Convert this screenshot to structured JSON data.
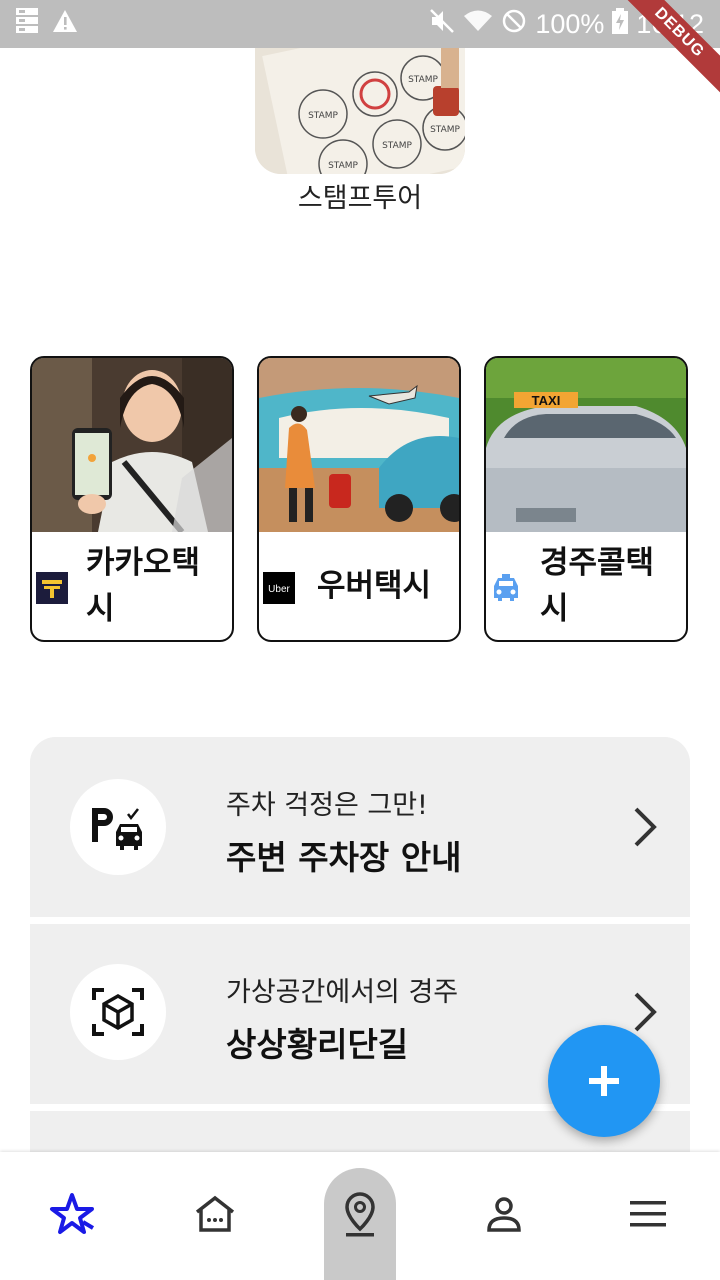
{
  "status_bar": {
    "battery": "100%",
    "time": "16:12"
  },
  "debug_banner": "DEBUG",
  "stamp_tour": {
    "label": "스탬프투어",
    "stamp_texts": [
      "STAMP",
      "STAMP",
      "STAMP",
      "STAMP",
      "STAMP"
    ]
  },
  "taxi_cards": [
    {
      "name": "카카오택시",
      "logo": "kakao-t-logo"
    },
    {
      "name": "우버택시",
      "logo": "uber-logo",
      "logo_text": "Uber"
    },
    {
      "name": "경주콜택시",
      "logo": "taxi-car-icon",
      "photo_sign": "TAXI"
    }
  ],
  "info_rows": [
    {
      "subtitle": "주차 걱정은 그만!",
      "title": "주변 주차장 안내",
      "icon": "parking-icon"
    },
    {
      "subtitle": "가상공간에서의 경주",
      "title": "상상황리단길",
      "icon": "ar-cube-icon"
    }
  ],
  "fab": {
    "label": "+"
  },
  "bottom_nav": {
    "items": [
      "star-icon",
      "home-icon",
      "location-icon",
      "person-icon",
      "menu-icon"
    ],
    "selected": "location-icon"
  },
  "colors": {
    "accent": "#2196f3",
    "panel": "#efefef",
    "status_bar": "#bdbdbd",
    "star": "#1a1ae6"
  }
}
